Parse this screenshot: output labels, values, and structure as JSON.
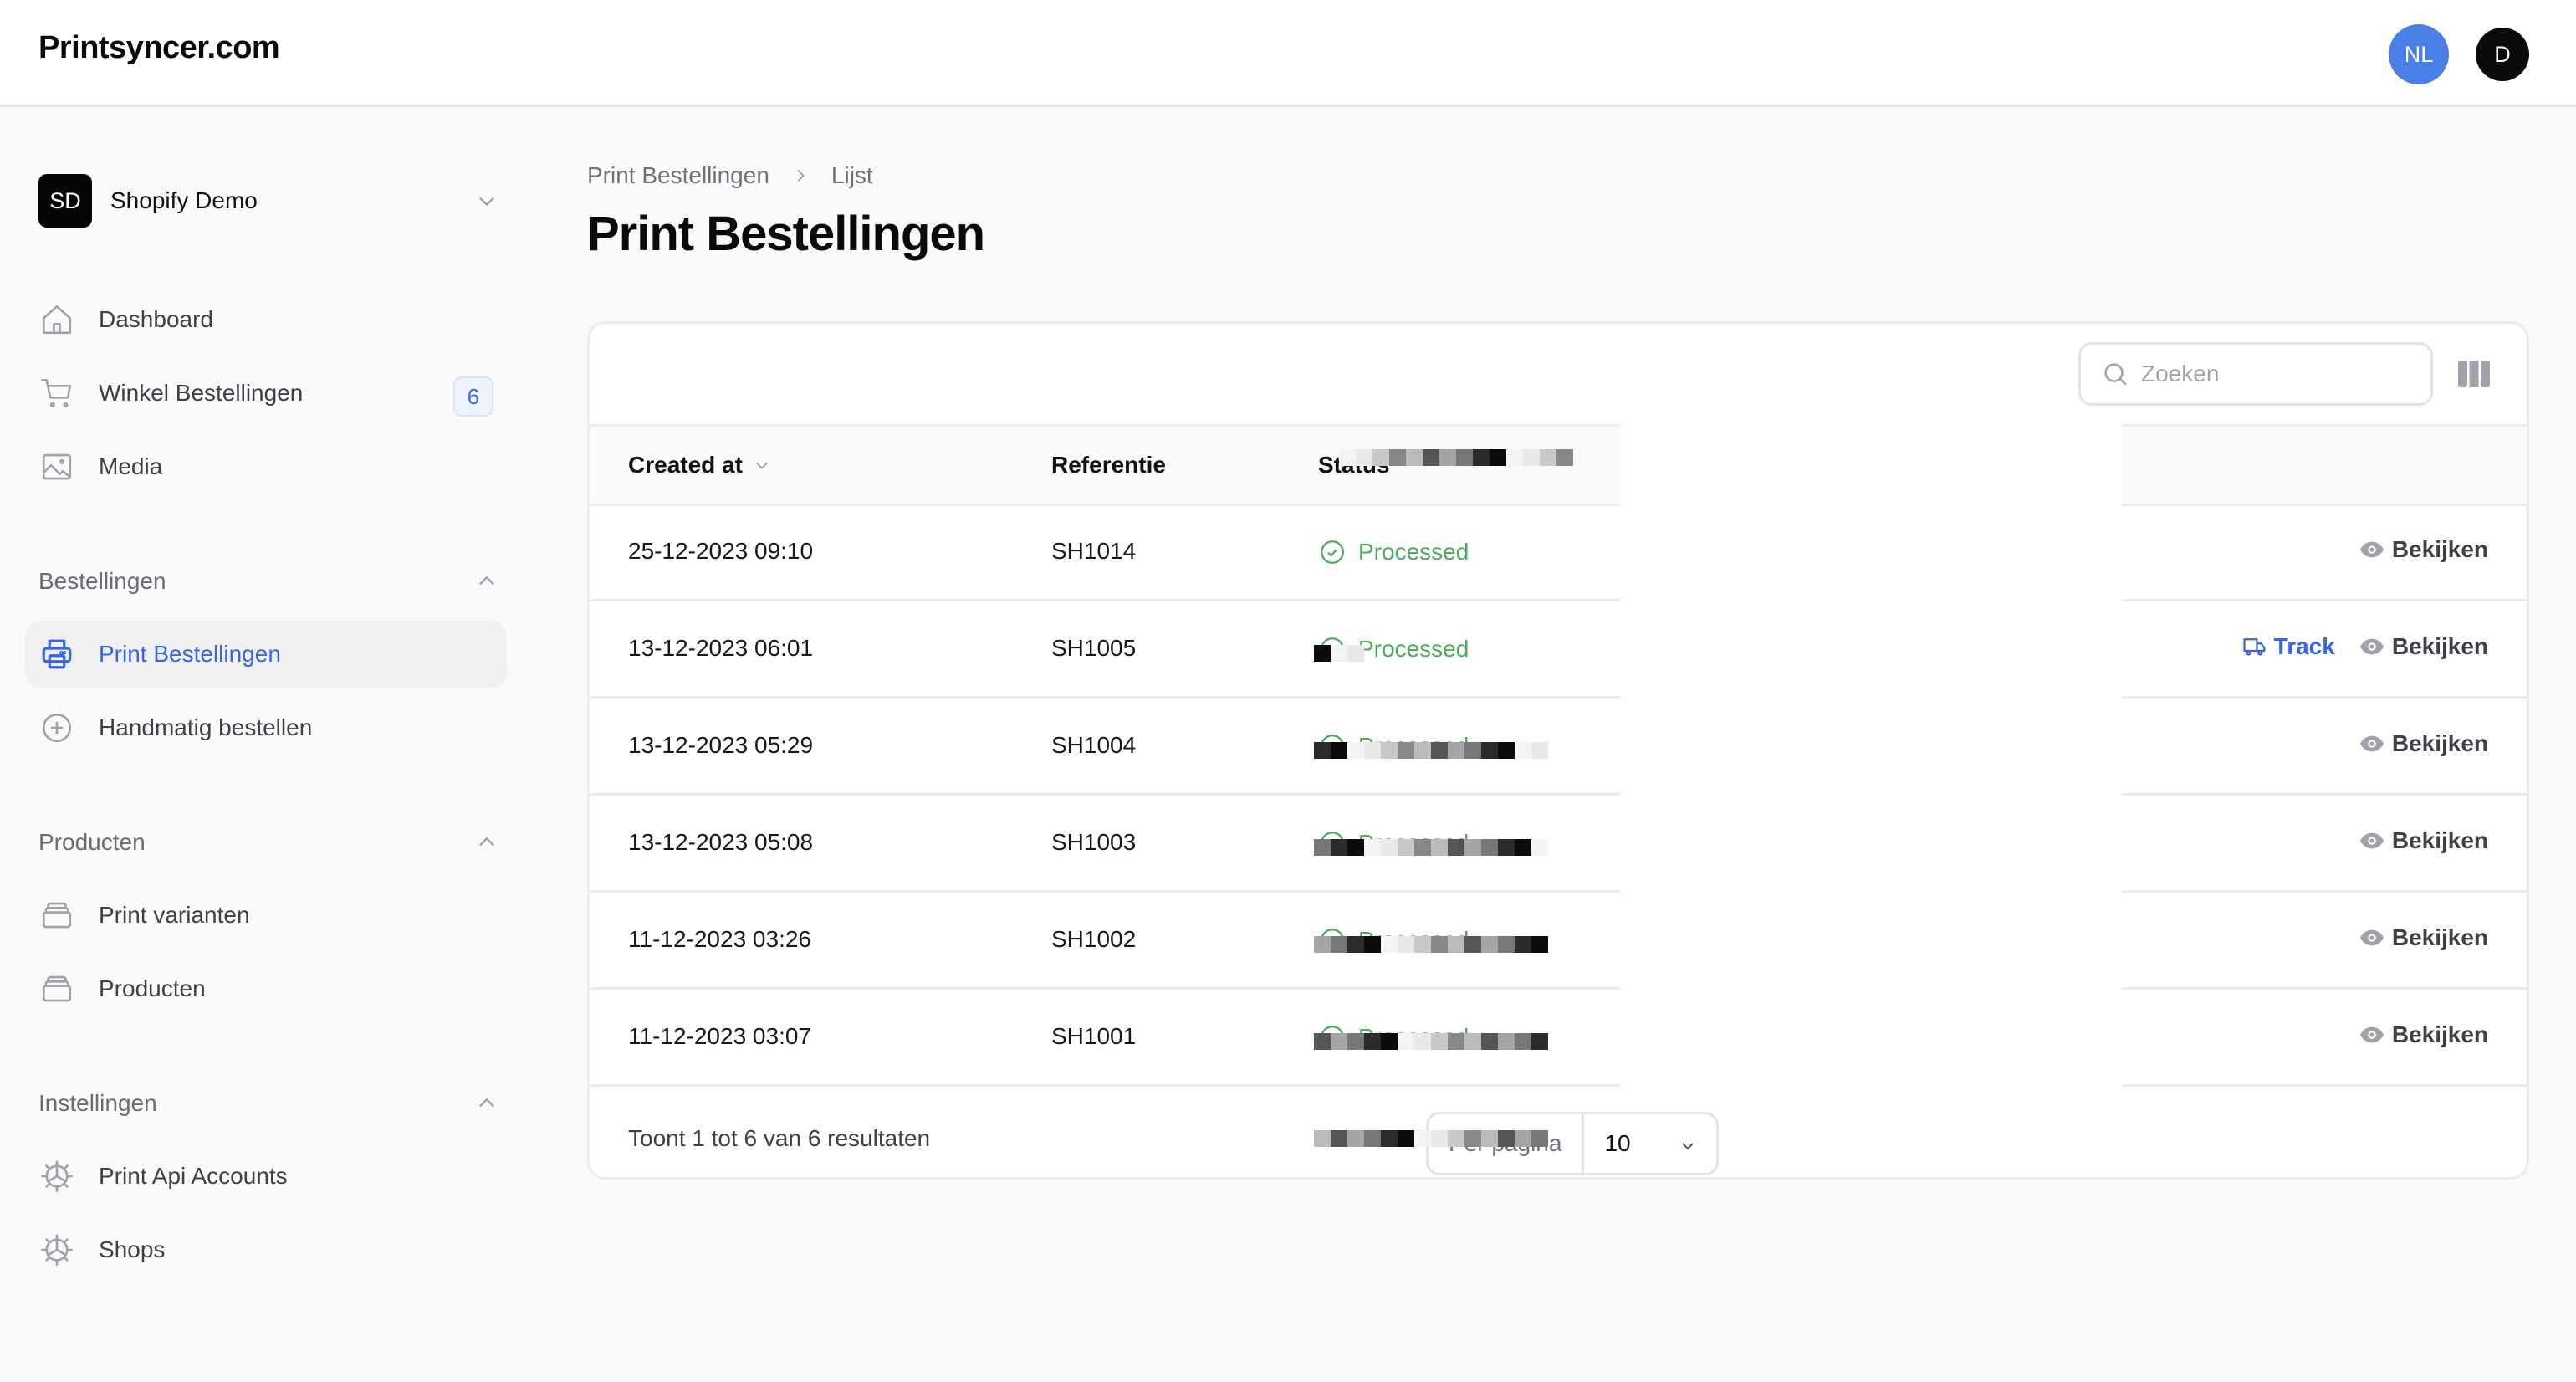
{
  "app": {
    "brand": "Printsyncer.com",
    "avatars": [
      {
        "initials": "NL",
        "color": "#4a7fe8"
      },
      {
        "initials": "D",
        "color": "#0a0a0b"
      }
    ]
  },
  "sidebar": {
    "shop": {
      "initials": "SD",
      "name": "Shopify Demo"
    },
    "top_items": [
      {
        "label": "Dashboard",
        "icon": "home-icon"
      },
      {
        "label": "Winkel Bestellingen",
        "icon": "cart-icon",
        "badge": "6"
      },
      {
        "label": "Media",
        "icon": "image-icon"
      }
    ],
    "groups": [
      {
        "label": "Bestellingen",
        "items": [
          {
            "label": "Print Bestellingen",
            "icon": "printer-icon",
            "active": true
          },
          {
            "label": "Handmatig bestellen",
            "icon": "plus-circle-icon"
          }
        ]
      },
      {
        "label": "Producten",
        "items": [
          {
            "label": "Print varianten",
            "icon": "stack-icon"
          },
          {
            "label": "Producten",
            "icon": "stack-icon"
          }
        ]
      },
      {
        "label": "Instellingen",
        "items": [
          {
            "label": "Print Api Accounts",
            "icon": "cog-icon"
          },
          {
            "label": "Shops",
            "icon": "cog-icon"
          }
        ]
      }
    ]
  },
  "main": {
    "breadcrumb": [
      "Print Bestellingen",
      "Lijst"
    ],
    "title": "Print Bestellingen",
    "search": {
      "placeholder": "Zoeken",
      "value": ""
    },
    "table": {
      "columns": [
        "Created at",
        "Referentie",
        "Status",
        "[redacted]"
      ],
      "rows": [
        {
          "created_at": "25-12-2023 09:10",
          "reference": "SH1014",
          "status": "Processed",
          "track": null,
          "view": "Bekijken"
        },
        {
          "created_at": "13-12-2023 06:01",
          "reference": "SH1005",
          "status": "Processed",
          "track": "Track",
          "view": "Bekijken"
        },
        {
          "created_at": "13-12-2023 05:29",
          "reference": "SH1004",
          "status": "Processed",
          "track": null,
          "view": "Bekijken"
        },
        {
          "created_at": "13-12-2023 05:08",
          "reference": "SH1003",
          "status": "Processed",
          "track": null,
          "view": "Bekijken"
        },
        {
          "created_at": "11-12-2023 03:26",
          "reference": "SH1002",
          "status": "Processed",
          "track": null,
          "view": "Bekijken"
        },
        {
          "created_at": "11-12-2023 03:07",
          "reference": "SH1001",
          "status": "Processed",
          "track": null,
          "view": "Bekijken"
        }
      ]
    },
    "footer": {
      "results_text": "Toont 1 tot 6 van 6 resultaten",
      "per_page_label": "Per pagina",
      "per_page_value": "10"
    }
  },
  "colors": {
    "accent": "#3866e0",
    "success": "#4aab5b",
    "muted": "#71717a"
  }
}
